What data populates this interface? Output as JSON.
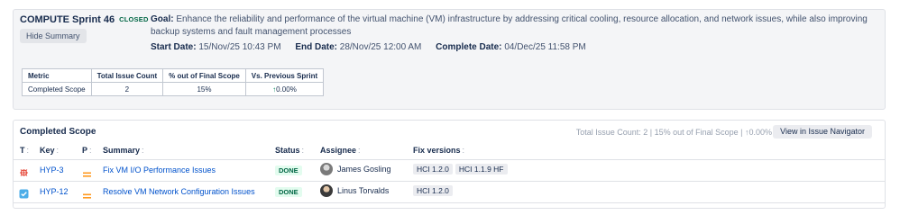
{
  "sprint": {
    "title": "COMPUTE Sprint 46",
    "status": "CLOSED",
    "hide_summary_label": "Hide Summary",
    "goal_label": "Goal:",
    "goal_text": "Enhance the reliability and performance of the virtual machine (VM) infrastructure by addressing critical cooling, resource allocation, and network issues, while also improving backup systems and fault management processes",
    "start_label": "Start Date:",
    "start_value": "15/Nov/25 10:43 PM",
    "end_label": "End Date:",
    "end_value": "28/Nov/25 12:00 AM",
    "complete_label": "Complete Date:",
    "complete_value": "04/Dec/25 11:58 PM"
  },
  "metrics": {
    "headers": [
      "Metric",
      "Total Issue Count",
      "% out of Final Scope",
      "Vs. Previous Sprint"
    ],
    "row": {
      "metric": "Completed Scope",
      "total": "2",
      "percent": "15%",
      "vs_arrow": "↑",
      "vs_value": "0.00%"
    }
  },
  "scope": {
    "title": "Completed Scope",
    "stats": "Total Issue Count: 2 | 15% out of Final Scope | ↑0.00%",
    "navigator_label": "View in Issue Navigator",
    "columns": {
      "type": "T",
      "key": "Key",
      "priority": "P",
      "summary": "Summary",
      "status": "Status",
      "assignee": "Assignee",
      "fix": "Fix versions"
    },
    "sort_glyph": ":",
    "rows": [
      {
        "type_icon": "bug-icon",
        "key": "HYP-3",
        "priority_icon": "priority-medium-icon",
        "summary": "Fix VM I/O Performance Issues",
        "status": "DONE",
        "assignee": "James Gosling",
        "fix_versions": [
          "HCI 1.2.0",
          "HCI 1.1.9 HF"
        ]
      },
      {
        "type_icon": "task-icon",
        "key": "HYP-12",
        "priority_icon": "priority-medium-icon",
        "summary": "Resolve VM Network Configuration Issues",
        "status": "DONE",
        "assignee": "Linus Torvalds",
        "fix_versions": [
          "HCI 1.2.0"
        ]
      }
    ]
  },
  "colors": {
    "link": "#0052cc",
    "done_bg": "#e3fcef",
    "done_text": "#006644",
    "bug": "#e5493a",
    "task": "#4bade8",
    "priority": "#ff991f",
    "up_arrow": "#00875a"
  }
}
